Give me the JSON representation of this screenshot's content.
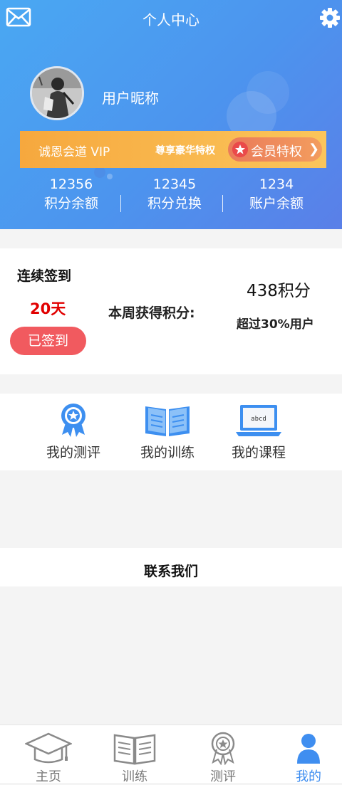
{
  "header": {
    "title": "个人中心",
    "nickname": "用户昵称"
  },
  "vip": {
    "text": "诚恩会道 VIP",
    "privilege": "尊享豪华特权",
    "button_label": "会员特权",
    "button_arrow": "❯"
  },
  "stats": [
    {
      "value": "12356",
      "label": "积分余额"
    },
    {
      "value": "12345",
      "label": "积分兑换"
    },
    {
      "value": "1234",
      "label": "账户余额"
    }
  ],
  "checkin": {
    "label": "连续签到",
    "days": "20天",
    "button": "已签到",
    "week_label": "本周获得积分:",
    "points": "438积分",
    "beat": "超过30%用户"
  },
  "shortcuts": [
    {
      "label": "我的测评",
      "icon": "ribbon-award-icon"
    },
    {
      "label": "我的训练",
      "icon": "open-book-icon"
    },
    {
      "label": "我的课程",
      "icon": "laptop-abcd-icon"
    }
  ],
  "laptop_screen_text": "abcd",
  "contact": {
    "label": "联系我们"
  },
  "tabbar": [
    {
      "label": "主页",
      "icon": "graduation-cap-icon",
      "active": false
    },
    {
      "label": "训练",
      "icon": "book-icon",
      "active": false
    },
    {
      "label": "测评",
      "icon": "award-icon",
      "active": false
    },
    {
      "label": "我的",
      "icon": "user-icon",
      "active": true
    }
  ],
  "colors": {
    "header_blue": "#4c94ee",
    "vip_orange": "#f6a83e",
    "signed_button": "#f15a5f",
    "days_red": "#e10000",
    "active_tab": "#3f8ef0"
  }
}
